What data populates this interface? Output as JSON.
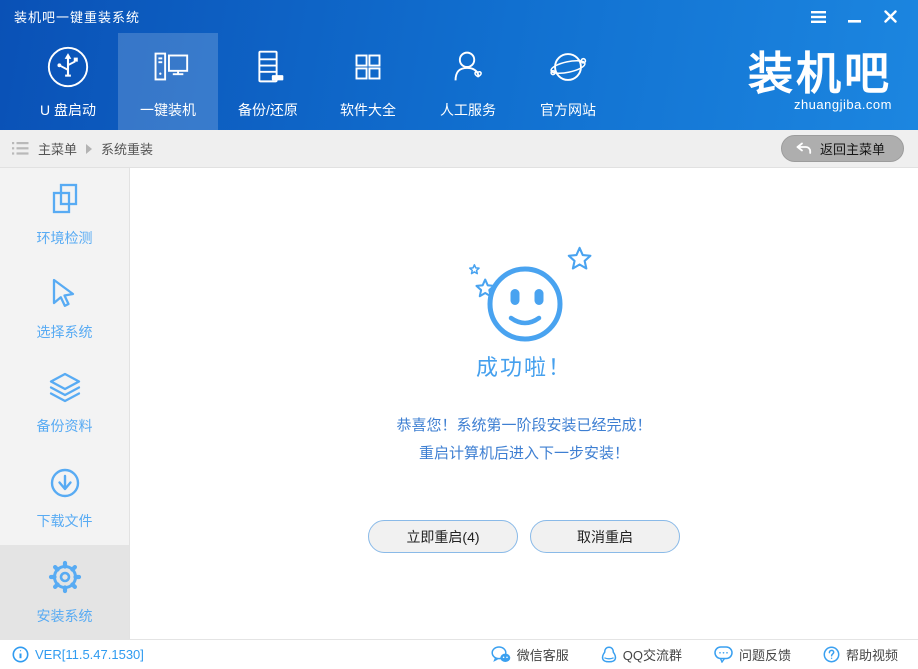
{
  "window": {
    "title": "装机吧一键重装系统"
  },
  "nav": {
    "items": [
      {
        "label": "U 盘启动",
        "icon": "usb",
        "active": false
      },
      {
        "label": "一键装机",
        "icon": "computer",
        "active": true
      },
      {
        "label": "备份/还原",
        "icon": "backup",
        "active": false
      },
      {
        "label": "软件大全",
        "icon": "apps",
        "active": false
      },
      {
        "label": "人工服务",
        "icon": "person",
        "active": false
      },
      {
        "label": "官方网站",
        "icon": "globe",
        "active": false
      }
    ],
    "logo": {
      "text": "装机吧",
      "domain": "zhuangjiba.com"
    }
  },
  "breadcrumb": {
    "root": "主菜单",
    "current": "系统重装",
    "back_button": "返回主菜单"
  },
  "sidebar": {
    "items": [
      {
        "label": "环境检测",
        "icon": "env-check",
        "active": false
      },
      {
        "label": "选择系统",
        "icon": "select-os",
        "active": false
      },
      {
        "label": "备份资料",
        "icon": "backup-data",
        "active": false
      },
      {
        "label": "下载文件",
        "icon": "download",
        "active": false
      },
      {
        "label": "安装系统",
        "icon": "install-gear",
        "active": true
      }
    ]
  },
  "main": {
    "headline": "成功啦！",
    "message_line1": "恭喜您！系统第一阶段安装已经完成！",
    "message_line2": "重启计算机后进入下一步安装！",
    "restart_button": "立即重启(4)",
    "cancel_button": "取消重启",
    "countdown": 4
  },
  "footer": {
    "version": "VER[11.5.47.1530]",
    "links": [
      {
        "label": "微信客服",
        "icon": "wechat"
      },
      {
        "label": "QQ交流群",
        "icon": "qq"
      },
      {
        "label": "问题反馈",
        "icon": "feedback"
      },
      {
        "label": "帮助视频",
        "icon": "help"
      }
    ]
  },
  "colors": {
    "header_blue_dark": "#0a51b6",
    "header_blue_light": "#1c86e0",
    "accent_blue": "#58abf3",
    "headline_blue": "#45a0ee",
    "message_blue": "#3e7fd2",
    "button_border_blue": "#8abae8",
    "back_button_gray": "#aeaeae"
  }
}
